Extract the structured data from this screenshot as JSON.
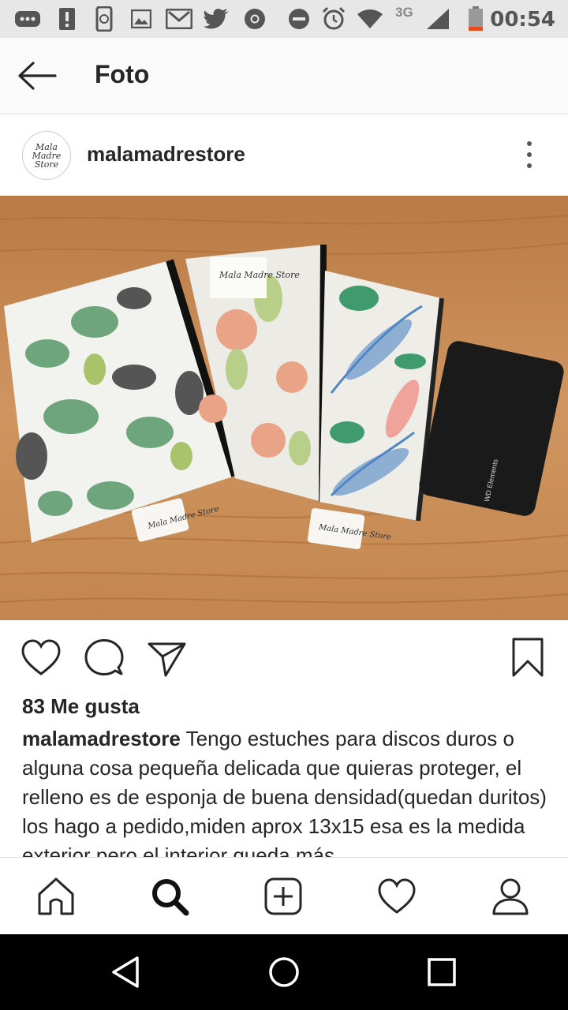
{
  "status_bar": {
    "time": "00:54",
    "network": "3G",
    "icons": [
      "more-notifications-icon",
      "alert-icon",
      "phone-sync-icon",
      "gallery-icon",
      "gmail-icon",
      "twitter-icon",
      "chrome-icon",
      "do-not-disturb-icon",
      "alarm-icon",
      "wifi-icon",
      "signal-icon",
      "battery-icon"
    ]
  },
  "app_bar": {
    "title": "Foto"
  },
  "post": {
    "username": "malamadrestore",
    "avatar_text": "Mala Madre Store",
    "photo_labels": {
      "tag": "Mala Madre Store",
      "drive": "WD Elements"
    },
    "likes": "83 Me gusta",
    "caption_user": "malamadrestore",
    "caption_text": " Tengo estuches para discos duros o alguna cosa pequeña delicada que quieras proteger, el relleno es de esponja de buena densidad(quedan duritos) los hago a pedido,miden aprox 13x15 esa es la medida exterior pero el interior queda más"
  },
  "bottom_nav": [
    "home-icon",
    "search-icon",
    "new-post-icon",
    "activity-icon",
    "profile-icon"
  ],
  "colors": {
    "status_bar": "#e7e7e7",
    "text": "#262626",
    "divider": "#dbdbdb",
    "wood": "#c8894f"
  }
}
